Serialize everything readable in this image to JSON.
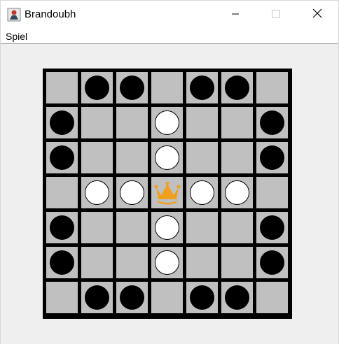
{
  "window": {
    "title": "Brandoubh",
    "app_icon": "game-app-icon",
    "controls": {
      "minimize": "minimize-icon",
      "maximize": "maximize-icon",
      "close": "close-icon"
    }
  },
  "menu": {
    "items": [
      {
        "label": "Spiel"
      }
    ]
  },
  "board": {
    "size": 7,
    "colors": {
      "cell": "#c0c0c0",
      "grid": "#000000",
      "attacker": "#000000",
      "defender": "#ffffff",
      "king": "#f0a020"
    },
    "rows": [
      [
        ".",
        "B",
        "B",
        ".",
        "B",
        "B",
        "."
      ],
      [
        "B",
        ".",
        ".",
        "W",
        ".",
        ".",
        "B"
      ],
      [
        "B",
        ".",
        ".",
        "W",
        ".",
        ".",
        "B"
      ],
      [
        ".",
        "W",
        "W",
        "K",
        "W",
        "W",
        "."
      ],
      [
        "B",
        ".",
        ".",
        "W",
        ".",
        ".",
        "B"
      ],
      [
        "B",
        ".",
        ".",
        "W",
        ".",
        ".",
        "B"
      ],
      [
        ".",
        "B",
        "B",
        ".",
        "B",
        "B",
        "."
      ]
    ],
    "legend": {
      "B": "attacker-piece",
      "W": "defender-piece",
      "K": "king-piece"
    }
  }
}
